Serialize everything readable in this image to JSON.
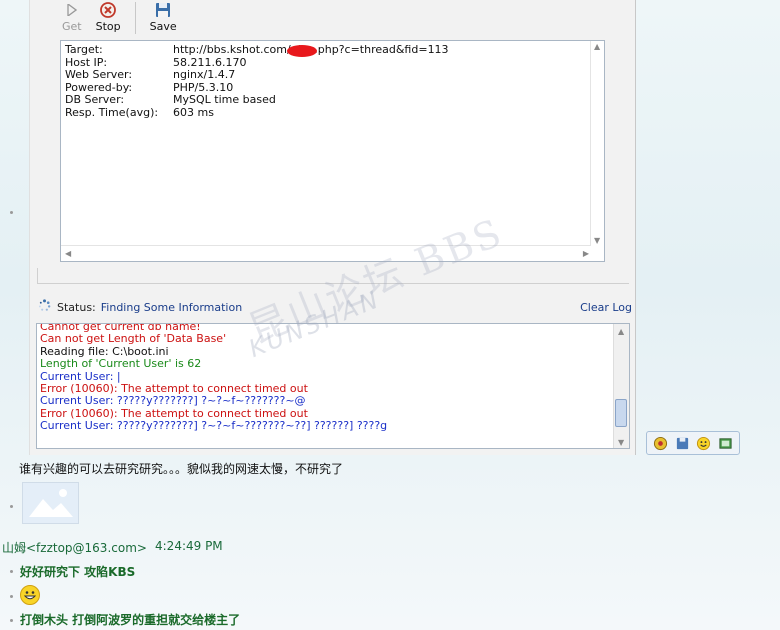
{
  "toolbar": {
    "get_label": "Get",
    "stop_label": "Stop",
    "save_label": "Save"
  },
  "info": {
    "rows": [
      {
        "label": "Target:",
        "value": "http://bbs.kshot.com/ dex.php?c=thread&fid=113"
      },
      {
        "label": "Host IP:",
        "value": "58.211.6.170"
      },
      {
        "label": "Web Server:",
        "value": "nginx/1.4.7"
      },
      {
        "label": "Powered-by:",
        "value": "PHP/5.3.10"
      },
      {
        "label": "DB Server:",
        "value": "MySQL time based"
      },
      {
        "label": "Resp. Time(avg):",
        "value": "603 ms"
      }
    ]
  },
  "status": {
    "label": "Status:",
    "text": "Finding Some Information",
    "clear_log": "Clear Log"
  },
  "log": [
    {
      "text": "Cannot get current db name!",
      "color": "red"
    },
    {
      "text": "Can not get Length of 'Data Base'",
      "color": "red"
    },
    {
      "text": "Reading file: C:\\boot.ini",
      "color": "black"
    },
    {
      "text": "Length of 'Current User' is 62",
      "color": "green"
    },
    {
      "text": "Current User: |",
      "color": "blue"
    },
    {
      "text": "Error (10060): The attempt to connect timed out",
      "color": "red"
    },
    {
      "text": "Current User: ?????y???????] ?~?~f~???????~@",
      "color": "blue"
    },
    {
      "text": "Error (10060): The attempt to connect timed out",
      "color": "red"
    },
    {
      "text": "Current User: ?????y???????] ?~?~f~???????~??] ??????] ????g",
      "color": "blue"
    }
  ],
  "watermark": {
    "main": "昆山论坛 BBS",
    "sub": "KUNSHAN"
  },
  "chat": {
    "message_1": "谁有兴趣的可以去研究研究。。。貌似我的网速太慢，不研究了",
    "sender": "山姆<fzztop@163.com>",
    "timestamp": "4:24:49 PM",
    "reply_1": "好好研究下 攻陷KBS",
    "reply_2": "打倒木头 打倒阿波罗的重担就交给楼主了"
  }
}
